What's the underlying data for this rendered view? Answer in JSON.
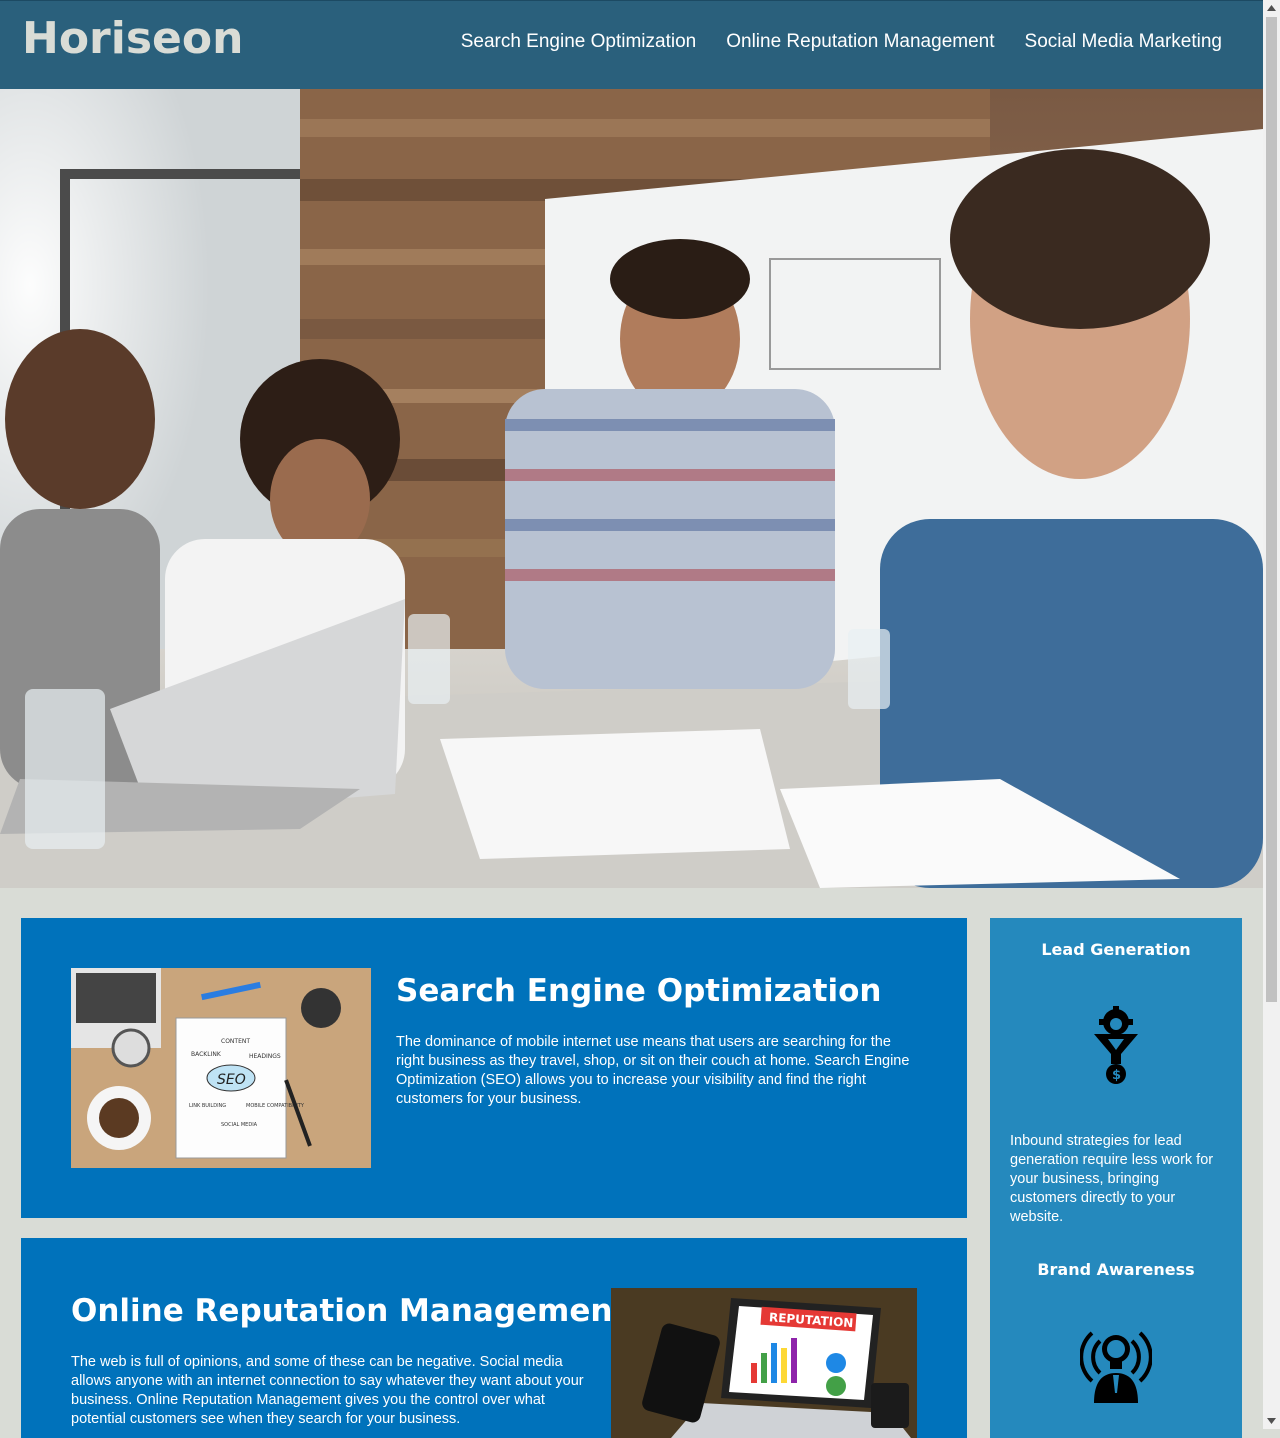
{
  "header": {
    "logo": "Horiseon",
    "nav": [
      "Search Engine Optimization",
      "Online Reputation Management",
      "Social Media Marketing"
    ]
  },
  "content": {
    "seo": {
      "title": "Search Engine Optimization",
      "text": "The dominance of mobile internet use means that users are searching for the right business as they travel, shop, or sit on their couch at home. Search Engine Optimization (SEO) allows you to increase your visibility and find the right customers for your business.",
      "image_words": [
        "CONTENT",
        "BACKLINK",
        "HEADINGS",
        "SEO",
        "LINK BUILDING",
        "MOBILE COMPATIBILITY",
        "SOCIAL MEDIA"
      ]
    },
    "orm": {
      "title": "Online Reputation Management",
      "text": "The web is full of opinions, and some of these can be negative. Social media allows anyone with an internet connection to say whatever they want about your business. Online Reputation Management gives you the control over what potential customers see when they search for your business.",
      "image_banner": "REPUTATION"
    }
  },
  "sidebar": {
    "lead": {
      "title": "Lead Generation",
      "text": "Inbound strategies for lead generation require less work for your business, bringing customers directly to your website."
    },
    "brand": {
      "title": "Brand Awareness"
    }
  },
  "colors": {
    "header_bg": "#2a607c",
    "logo": "#d9dcd6",
    "page_bg": "#d9dcd6",
    "card_bg": "#0072bb",
    "sidebar_bg": "#2589bd"
  },
  "icons": [
    "lead-generation-icon",
    "brand-awareness-icon",
    "scroll-up-arrow-icon",
    "scroll-down-arrow-icon"
  ]
}
